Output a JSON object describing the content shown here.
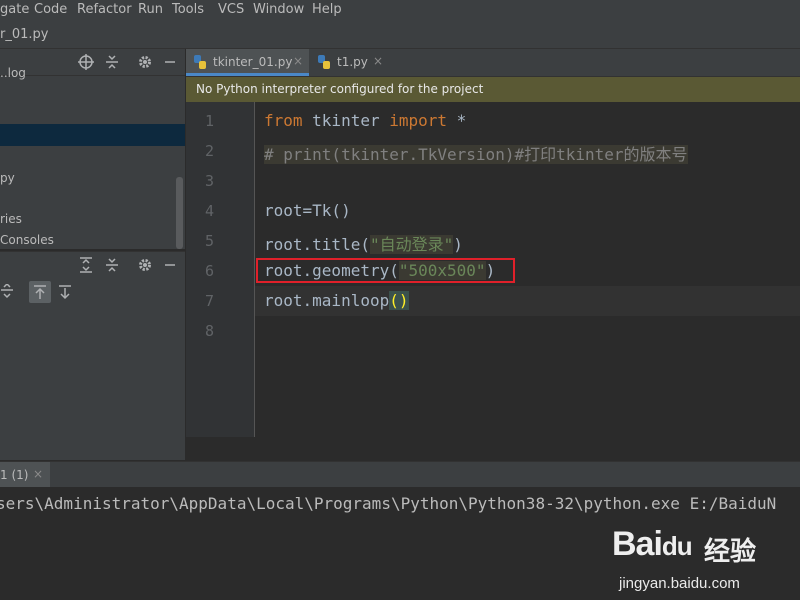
{
  "menu": [
    "gate",
    "Code",
    "Refactor",
    "Run",
    "Tools",
    "VCS",
    "Window",
    "Help"
  ],
  "breadcrumb": "r_01.py",
  "project_tree": {
    "items": [
      "..log",
      "py",
      "ries",
      " Consoles"
    ]
  },
  "tabs": [
    {
      "label": "tkinter_01.py",
      "close": "×"
    },
    {
      "label": "t1.py",
      "close": "×"
    }
  ],
  "banner": "No Python interpreter configured for the project",
  "line_numbers": [
    "1",
    "2",
    "3",
    "4",
    "5",
    "6",
    "7",
    "8"
  ],
  "code": {
    "l1_kw1": "from",
    "l1_mid": " tkinter ",
    "l1_kw2": "import",
    "l1_end": " *",
    "l2": "# print(tkinter.TkVersion)#打印tkinter的版本号",
    "l4": "root=Tk()",
    "l5_a": "root.title(",
    "l5_str": "\"自动登录\"",
    "l5_b": ")",
    "l6_a": "root.geometry(",
    "l6_str": "\"500x500\"",
    "l6_b": ")",
    "l7_a": "root.mainloop",
    "l7_br": "()"
  },
  "run_tab": {
    "label": "1 (1)",
    "close": "×"
  },
  "console": "sers\\Administrator\\AppData\\Local\\Programs\\Python\\Python38-32\\python.exe E:/BaiduN",
  "watermark": {
    "brand": "Bai",
    "paw": "du",
    "jy": "经验",
    "url": "jingyan.baidu.com"
  },
  "colors": {
    "accent": "#4a88c7",
    "highlight_box": "#e0202a",
    "banner": "#5a5934"
  },
  "icons": [
    "target-icon",
    "collapse-icon",
    "gear-icon",
    "minimize-icon",
    "python-file-icon",
    "expand-icon",
    "sort-up-icon",
    "sort-down-icon"
  ]
}
